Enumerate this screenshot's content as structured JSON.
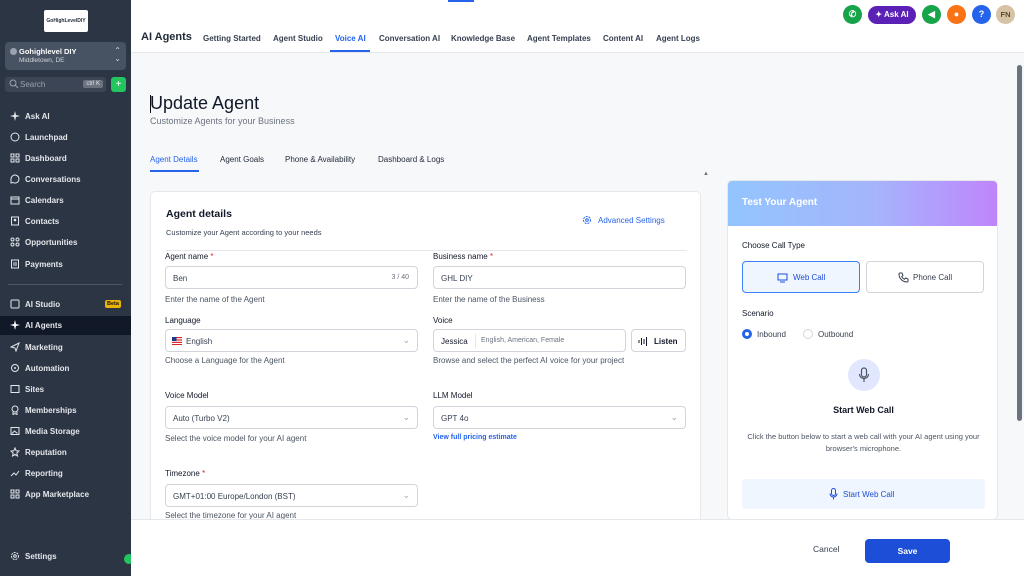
{
  "sidebar": {
    "logo_text": "GoHighLevelDIY",
    "account": {
      "name": "Gohighlevel DIY",
      "location": "Middletown, DE"
    },
    "search": {
      "placeholder": "Search",
      "shortcut": "ctrl K"
    },
    "items": [
      {
        "label": "Ask AI",
        "icon": "sparkle-icon"
      },
      {
        "label": "Launchpad",
        "icon": "rocket-icon"
      },
      {
        "label": "Dashboard",
        "icon": "dashboard-icon"
      },
      {
        "label": "Conversations",
        "icon": "chat-icon"
      },
      {
        "label": "Calendars",
        "icon": "calendar-icon"
      },
      {
        "label": "Contacts",
        "icon": "contacts-icon"
      },
      {
        "label": "Opportunities",
        "icon": "opportunities-icon"
      },
      {
        "label": "Payments",
        "icon": "payments-icon"
      }
    ],
    "items2": [
      {
        "label": "AI Studio",
        "icon": "ai-studio-icon",
        "badge": "Beta"
      },
      {
        "label": "AI Agents",
        "icon": "sparkle-icon",
        "active": true
      },
      {
        "label": "Marketing",
        "icon": "send-icon"
      },
      {
        "label": "Automation",
        "icon": "automation-icon"
      },
      {
        "label": "Sites",
        "icon": "globe-icon"
      },
      {
        "label": "Memberships",
        "icon": "membership-icon"
      },
      {
        "label": "Media Storage",
        "icon": "media-icon"
      },
      {
        "label": "Reputation",
        "icon": "star-icon"
      },
      {
        "label": "Reporting",
        "icon": "chart-icon"
      },
      {
        "label": "App Marketplace",
        "icon": "grid-icon"
      }
    ],
    "settings_label": "Settings"
  },
  "topbar": {
    "title": "AI Agents",
    "tabs": [
      "Getting Started",
      "Agent Studio",
      "Voice AI",
      "Conversation AI",
      "Knowledge Base",
      "Agent Templates",
      "Content AI",
      "Agent Logs"
    ],
    "active_tab": "Voice AI",
    "ask_ai_label": "Ask AI",
    "avatar_initials": "FN",
    "help_label": "?"
  },
  "page": {
    "title": "Update Agent",
    "subtitle": "Customize Agents for your Business",
    "tabs": [
      "Agent Details",
      "Agent Goals",
      "Phone & Availability",
      "Dashboard & Logs"
    ]
  },
  "agent_details": {
    "title": "Agent details",
    "subtitle": "Customize your Agent according to your needs",
    "advanced_settings": "Advanced Settings",
    "agent_name": {
      "label": "Agent name",
      "value": "Ben",
      "count": "3 / 40",
      "help": "Enter the name of the Agent"
    },
    "business_name": {
      "label": "Business name",
      "value": "GHL DIY",
      "help": "Enter the name of the Business"
    },
    "language": {
      "label": "Language",
      "value": "English",
      "help": "Choose a Language for the Agent"
    },
    "voice": {
      "label": "Voice",
      "name": "Jessica",
      "desc": "English, American, Female",
      "listen": "Listen",
      "help": "Browse and select the perfect AI voice for your project"
    },
    "voice_model": {
      "label": "Voice Model",
      "value": "Auto (Turbo V2)",
      "help": "Select the voice model for your AI agent"
    },
    "llm_model": {
      "label": "LLM Model",
      "value": "GPT 4o",
      "link": "View full pricing estimate"
    },
    "timezone": {
      "label": "Timezone",
      "value": "GMT+01:00 Europe/London (BST)",
      "help": "Select the timezone for your AI agent"
    },
    "required_mark": "*"
  },
  "test_panel": {
    "title": "Test Your Agent",
    "call_type_label": "Choose Call Type",
    "web_call": "Web Call",
    "phone_call": "Phone Call",
    "scenario_label": "Scenario",
    "inbound": "Inbound",
    "outbound": "Outbound",
    "start_title": "Start Web Call",
    "desc": "Click the button below to start a web call with your AI agent using your browser's microphone.",
    "start_button": "Start Web Call"
  },
  "footer": {
    "cancel": "Cancel",
    "save": "Save"
  },
  "colors": {
    "accent": "#2563eb",
    "sidebar_bg": "#2b3544",
    "save_bg": "#1d4ed8"
  }
}
